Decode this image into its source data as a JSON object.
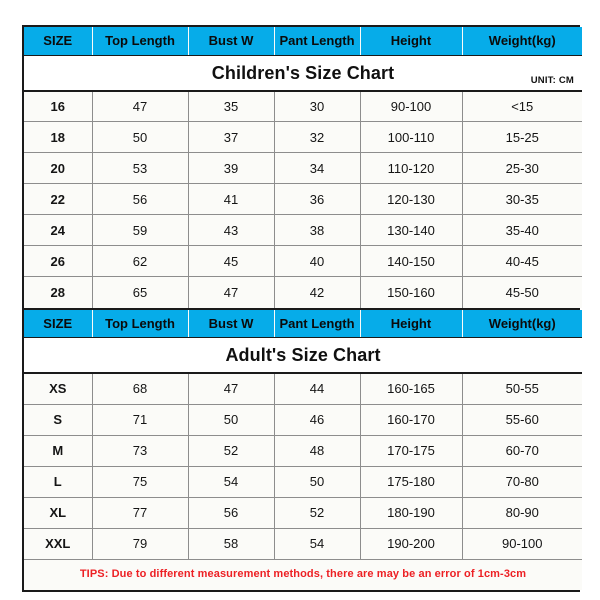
{
  "unit_label": "UNIT: CM",
  "columns": [
    "SIZE",
    "Top Length",
    "Bust W",
    "Pant Length",
    "Height",
    "Weight(kg)"
  ],
  "colors": {
    "header_blue": "#06ACE9",
    "cell_background": "#fbfbf8",
    "border_dark": "#1a1a1a",
    "border_light": "#8d8d8d",
    "tips_red": "#ED2024",
    "text_dark": "#101010"
  },
  "children_chart": {
    "title": "Children's Size Chart",
    "columns": [
      "SIZE",
      "Top Length",
      "Bust W",
      "Pant Length",
      "Height",
      "Weight(kg)"
    ],
    "rows": [
      [
        "16",
        "47",
        "35",
        "30",
        "90-100",
        "<15"
      ],
      [
        "18",
        "50",
        "37",
        "32",
        "100-110",
        "15-25"
      ],
      [
        "20",
        "53",
        "39",
        "34",
        "110-120",
        "25-30"
      ],
      [
        "22",
        "56",
        "41",
        "36",
        "120-130",
        "30-35"
      ],
      [
        "24",
        "59",
        "43",
        "38",
        "130-140",
        "35-40"
      ],
      [
        "26",
        "62",
        "45",
        "40",
        "140-150",
        "40-45"
      ],
      [
        "28",
        "65",
        "47",
        "42",
        "150-160",
        "45-50"
      ]
    ]
  },
  "adult_chart": {
    "title": "Adult's Size Chart",
    "columns": [
      "SIZE",
      "Top Length",
      "Bust W",
      "Pant Length",
      "Height",
      "Weight(kg)"
    ],
    "rows": [
      [
        "XS",
        "68",
        "47",
        "44",
        "160-165",
        "50-55"
      ],
      [
        "S",
        "71",
        "50",
        "46",
        "160-170",
        "55-60"
      ],
      [
        "M",
        "73",
        "52",
        "48",
        "170-175",
        "60-70"
      ],
      [
        "L",
        "75",
        "54",
        "50",
        "175-180",
        "70-80"
      ],
      [
        "XL",
        "77",
        "56",
        "52",
        "180-190",
        "80-90"
      ],
      [
        "XXL",
        "79",
        "58",
        "54",
        "190-200",
        "90-100"
      ]
    ]
  },
  "tips": "TIPS: Due to different measurement methods, there are may be an error of 1cm-3cm"
}
